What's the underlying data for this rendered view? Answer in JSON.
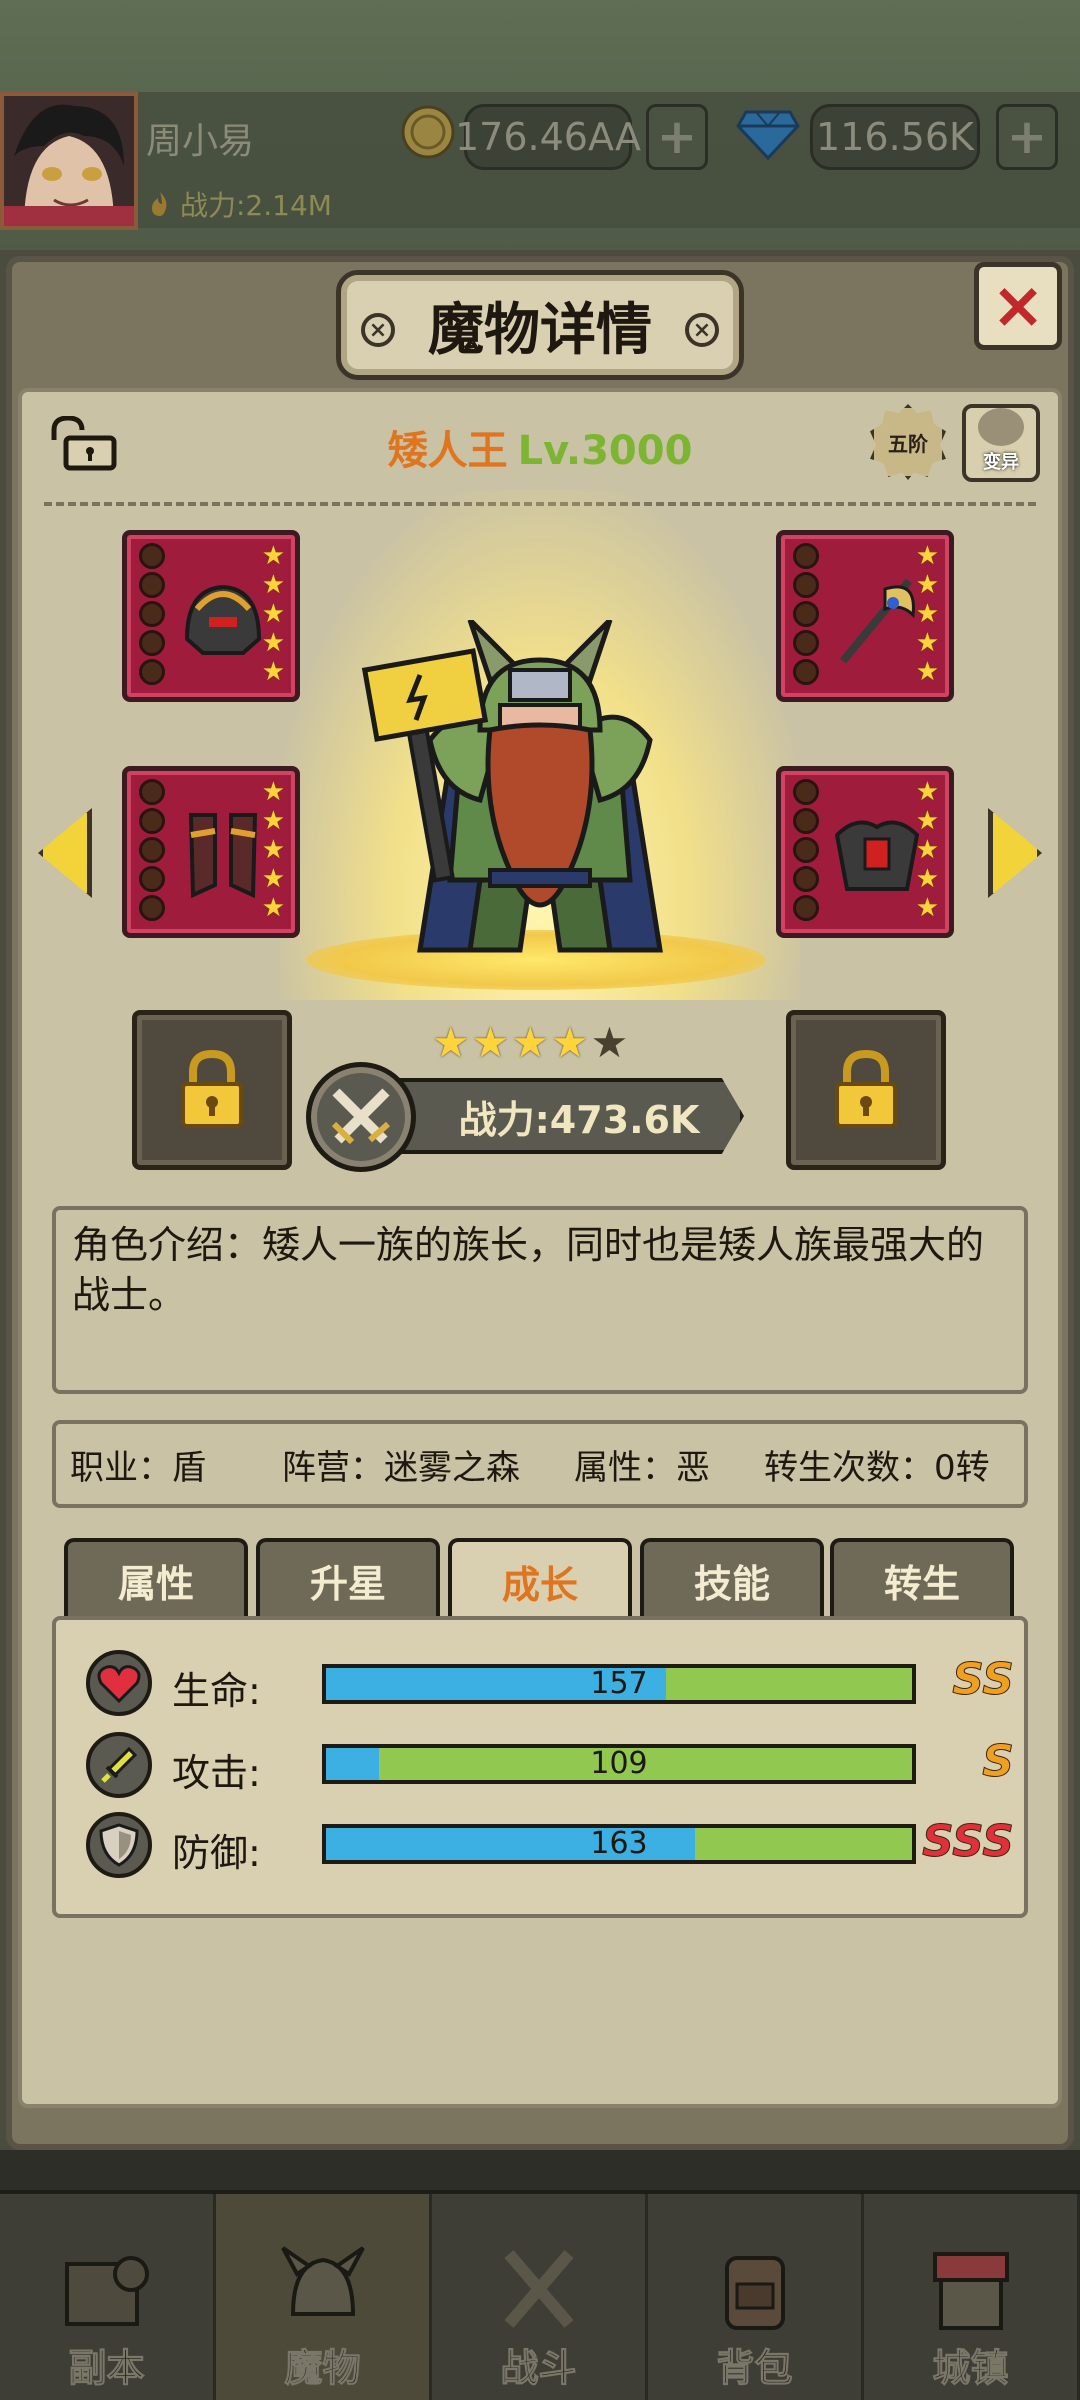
{
  "header": {
    "player_name": "周小易",
    "power_label": "战力:2.14M",
    "gold": "176.46AA",
    "gems": "116.56K",
    "plus": "+"
  },
  "dialog": {
    "title": "魔物详情",
    "close": "×"
  },
  "monster": {
    "name": "矮人王",
    "level": "Lv.3000",
    "rank": "五阶",
    "mutate": "变异",
    "stars_filled": 4,
    "stars_total": 5,
    "power": "战力:473.6K",
    "intro": "角色介绍：矮人一族的族长，同时也是矮人族最强大的战士。",
    "job": "职业：盾",
    "faction": "阵营：迷雾之森",
    "attr": "属性：恶",
    "rebirth": "转生次数：0转"
  },
  "tabs": [
    {
      "label": "属性"
    },
    {
      "label": "升星"
    },
    {
      "label": "成长"
    },
    {
      "label": "技能"
    },
    {
      "label": "转生"
    }
  ],
  "active_tab": "成长",
  "growth": [
    {
      "label": "生命:",
      "value": "157",
      "fill_fraction": 0.58,
      "grade": "SS",
      "grade_color": "#f0a020"
    },
    {
      "label": "攻击:",
      "value": "109",
      "fill_fraction": 0.09,
      "grade": "S",
      "grade_color": "#f0a020"
    },
    {
      "label": "防御:",
      "value": "163",
      "fill_fraction": 0.63,
      "grade": "SSS",
      "grade_color": "#e0303a"
    }
  ],
  "nav": [
    {
      "label": "副本",
      "icon": "map-icon"
    },
    {
      "label": "魔物",
      "icon": "monster-helmet-icon"
    },
    {
      "label": "战斗",
      "icon": "swords-icon"
    },
    {
      "label": "背包",
      "icon": "backpack-icon"
    },
    {
      "label": "城镇",
      "icon": "town-shop-icon"
    }
  ],
  "colors": {
    "name_orange": "#e07520",
    "level_green": "#7bb531",
    "bar_blue": "#3cb0e2",
    "bar_green": "#90c850",
    "equip_red": "#a01c3c"
  }
}
